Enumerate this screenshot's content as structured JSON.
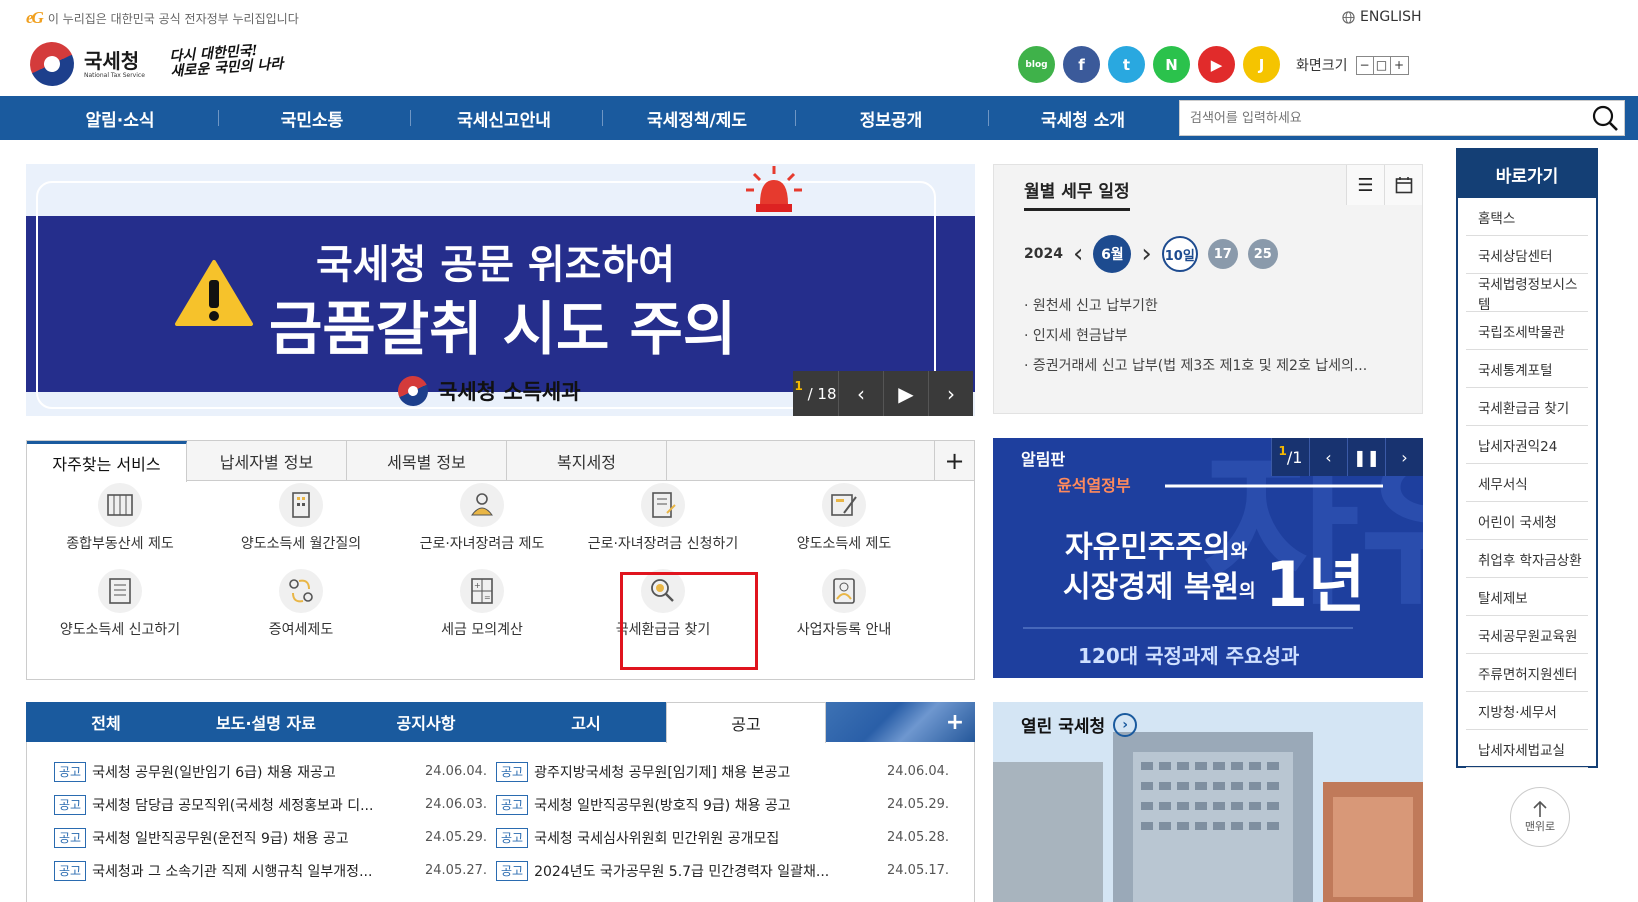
{
  "header": {
    "gov_notice": "이 누리집은 대한민국 공식 전자정부 누리집입니다",
    "gov_logo": "eG",
    "english": "ENGLISH",
    "logo_title": "국세청",
    "logo_sub": "National Tax Service",
    "slogan_line1": "다시 대한민국!",
    "slogan_line2": "새로운 국민의 나라",
    "font_size_label": "화면크기",
    "font_minus": "−",
    "font_reset": "□",
    "font_plus": "+",
    "sns": [
      {
        "name": "blog-icon",
        "glyph": "blog",
        "color": "#3fb24a"
      },
      {
        "name": "facebook-icon",
        "glyph": "f",
        "color": "#3b5a9a"
      },
      {
        "name": "twitter-icon",
        "glyph": "t",
        "color": "#29a8e0"
      },
      {
        "name": "naver-post-icon",
        "glyph": "N",
        "color": "#2bc24c"
      },
      {
        "name": "youtube-icon",
        "glyph": "▶",
        "color": "#e12b2b"
      },
      {
        "name": "kakao-icon",
        "glyph": "J",
        "color": "#f5c400"
      }
    ]
  },
  "nav": {
    "items": [
      "알림·소식",
      "국민소통",
      "국세신고안내",
      "국세정책/제도",
      "정보공개",
      "국세청 소개"
    ],
    "search_placeholder": "검색어를 입력하세요"
  },
  "banner": {
    "line1": "국세청 공문 위조하여",
    "line2": "금품갈취 시도 주의",
    "footer": "국세청 소득세과",
    "page_current": "1",
    "page_total": "/ 18"
  },
  "schedule": {
    "title": "월별 세무 일정",
    "year": "2024",
    "month": "6월",
    "days": [
      "10일",
      "17",
      "25"
    ],
    "items": [
      "원천세 신고 납부기한",
      "인지세 현금납부",
      "증권거래세 신고 납부(법 제3조 제1호 및 제2호 납세의..."
    ]
  },
  "quick": {
    "title": "바로가기",
    "items": [
      "홈택스",
      "국세상담센터",
      "국세법령정보시스템",
      "국립조세박물관",
      "국세통계포털",
      "국세환급금 찾기",
      "납세자권익24",
      "세무서식",
      "어린이 국세청",
      "취업후 학자금상환",
      "탈세제보",
      "국세공무원교육원",
      "주류면허지원센터",
      "지방청·세무서",
      "납세자세법교실"
    ],
    "top": "맨위로"
  },
  "services": {
    "tabs": [
      "자주찾는 서비스",
      "납세자별 정보",
      "세목별 정보",
      "복지세정"
    ],
    "plus": "+",
    "items": [
      "종합부동산세 제도",
      "양도소득세 월간질의",
      "근로·자녀장려금 제도",
      "근로·자녀장려금 신청하기",
      "양도소득세 제도",
      "양도소득세 신고하기",
      "증여세제도",
      "세금 모의계산",
      "국세환급금 찾기",
      "사업자등록 안내"
    ]
  },
  "notice": {
    "tabs": [
      "전체",
      "보도·설명 자료",
      "공지사항",
      "고시",
      "공고"
    ],
    "plus": "+",
    "tag": "공고",
    "left": [
      {
        "title": "국세청 공무원(일반임기 6급) 채용 재공고",
        "date": "24.06.04."
      },
      {
        "title": "국세청 담당급 공모직위(국세청 세정홍보과 디...",
        "date": "24.06.03."
      },
      {
        "title": "국세청 일반직공무원(운전직 9급) 채용 공고",
        "date": "24.05.29."
      },
      {
        "title": "국세청과 그 소속기관 직제 시행규칙 일부개정...",
        "date": "24.05.27."
      }
    ],
    "right": [
      {
        "title": "광주지방국세청 공무원[임기제] 채용 본공고",
        "date": "24.06.04."
      },
      {
        "title": "국세청 일반직공무원(방호직 9급) 채용 공고",
        "date": "24.05.29."
      },
      {
        "title": "국세청 국세심사위원회 민간위원 공개모집",
        "date": "24.05.28."
      },
      {
        "title": "2024년도 국가공무원 5.7급 민간경력자 일괄채...",
        "date": "24.05.17."
      }
    ]
  },
  "board": {
    "title": "알림판",
    "page_current": "1",
    "page_total": "/1",
    "gov_name": "윤석열정부",
    "line1a": "자유민주주의",
    "line1b": "와",
    "line2a": "시장경제 복원",
    "line2b": "의",
    "year": "1년",
    "bottom": "120대 국정과제 주요성과"
  },
  "open": {
    "title": "열린 국세청",
    "arrow": "›"
  }
}
